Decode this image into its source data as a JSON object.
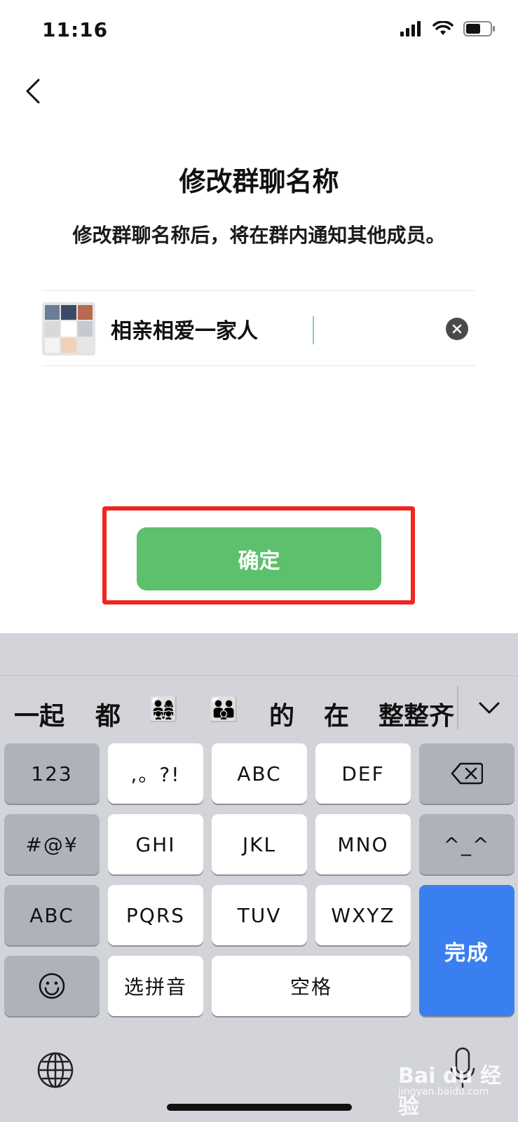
{
  "status": {
    "time": "11:16"
  },
  "page": {
    "title": "修改群聊名称",
    "subtitle": "修改群聊名称后，将在群内通知其他成员。"
  },
  "name_field": {
    "value": "相亲相爱一家人"
  },
  "confirm": {
    "label": "确定"
  },
  "colors": {
    "accent": "#5cc06c",
    "highlight": "#f2241f",
    "keyboard_blue": "#3a7ff0"
  },
  "keyboard": {
    "candidates": [
      "一起",
      "都",
      "👨‍👩‍👧‍👧",
      "👨‍👨‍👦",
      "的",
      "在",
      "整整齐"
    ],
    "keys": {
      "num": "123",
      "punct": ",。?!",
      "abc1": "ABC",
      "def": "DEF",
      "sym": "#@¥",
      "ghi": "GHI",
      "jkl": "JKL",
      "mno": "MNO",
      "face": "^_^",
      "abc_mode": "ABC",
      "pqrs": "PQRS",
      "tuv": "TUV",
      "wxyz": "WXYZ",
      "done": "完成",
      "pinyin": "选拼音",
      "space": "空格"
    }
  },
  "watermark": {
    "brand": "Bai du 经验",
    "site": "jingyan.baidu.com"
  }
}
